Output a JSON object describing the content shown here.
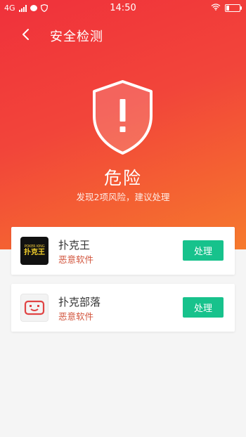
{
  "status_bar": {
    "network": "4G",
    "time": "14:50"
  },
  "header": {
    "title": "安全检测"
  },
  "result": {
    "level": "危险",
    "summary": "发现2项风险，建议处理"
  },
  "risks": [
    {
      "name": "扑克王",
      "tag": "恶意软件",
      "action": "处理",
      "icon": "poker-king-app-icon",
      "icon_text_small": "POKER KING",
      "icon_text_big": "扑克王"
    },
    {
      "name": "扑克部落",
      "tag": "恶意软件",
      "action": "处理",
      "icon": "poker-tribe-app-icon"
    }
  ],
  "colors": {
    "gradient_top": "#f0313b",
    "gradient_bottom": "#f67a2d",
    "action_button": "#17c28c",
    "tag": "#d2553d"
  }
}
